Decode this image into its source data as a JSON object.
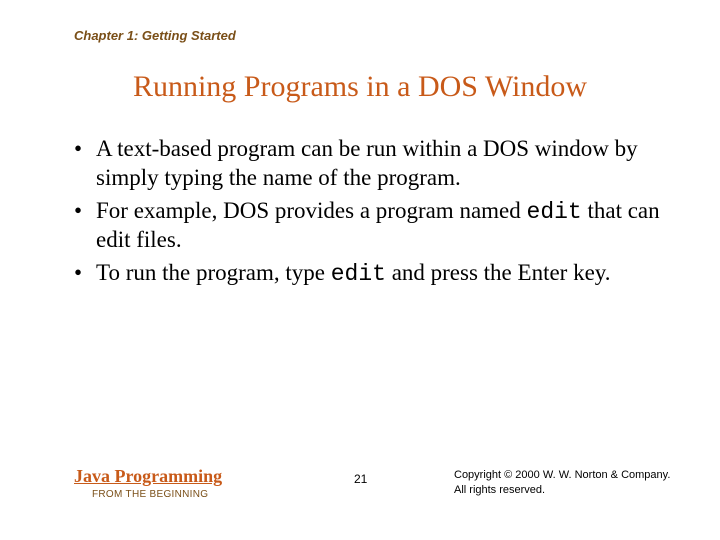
{
  "chapter": "Chapter 1: Getting Started",
  "title": "Running Programs in a DOS Window",
  "bullets": {
    "b1a": "A text-based program can be run within a DOS window by simply typing the name of the program.",
    "b2a": "For example, DOS provides a program named ",
    "b2code": "edit",
    "b2b": " that can edit files.",
    "b3a": "To run the program, type ",
    "b3code": "edit",
    "b3b": " and press the Enter key."
  },
  "footer": {
    "book": "Java Programming",
    "subtitle": "FROM THE BEGINNING",
    "page": "21",
    "copyright1": "Copyright © 2000 W. W. Norton & Company.",
    "copyright2": "All rights reserved."
  }
}
